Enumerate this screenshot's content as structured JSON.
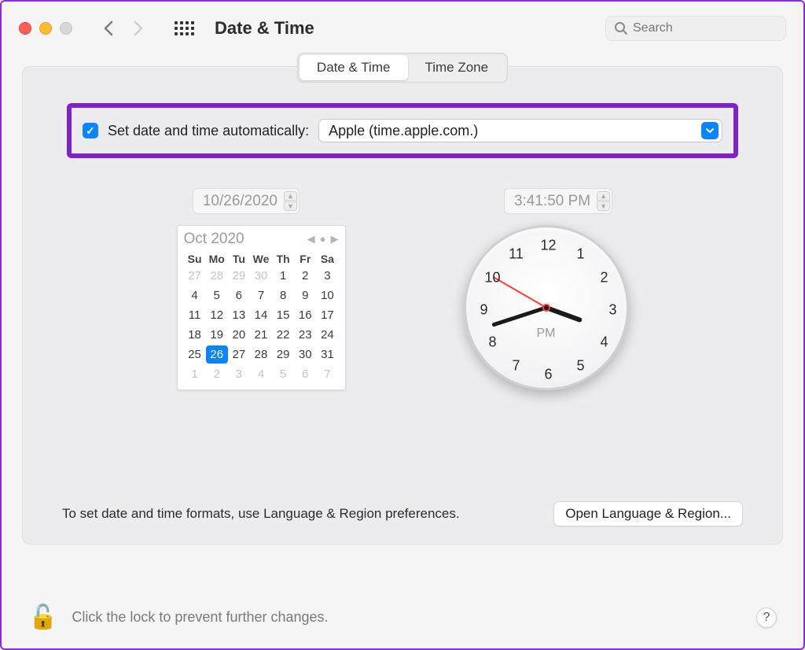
{
  "window": {
    "title": "Date & Time",
    "search_placeholder": "Search"
  },
  "tabs": {
    "date_time": "Date & Time",
    "time_zone": "Time Zone",
    "active": "date_time"
  },
  "auto": {
    "checked": true,
    "label": "Set date and time automatically:",
    "server": "Apple (time.apple.com.)"
  },
  "date_field": "10/26/2020",
  "time_field": "3:41:50 PM",
  "calendar": {
    "month_label": "Oct 2020",
    "dow": [
      "Su",
      "Mo",
      "Tu",
      "We",
      "Th",
      "Fr",
      "Sa"
    ],
    "leading_out": [
      27,
      28,
      29,
      30
    ],
    "days": [
      1,
      2,
      3,
      4,
      5,
      6,
      7,
      8,
      9,
      10,
      11,
      12,
      13,
      14,
      15,
      16,
      17,
      18,
      19,
      20,
      21,
      22,
      23,
      24,
      25,
      26,
      27,
      28,
      29,
      30,
      31
    ],
    "trailing_out": [
      1,
      2,
      3,
      4,
      5,
      6,
      7
    ],
    "selected": 26
  },
  "clock": {
    "numbers": [
      "12",
      "1",
      "2",
      "3",
      "4",
      "5",
      "6",
      "7",
      "8",
      "9",
      "10",
      "11"
    ],
    "ampm": "PM",
    "hour_angle": 110,
    "minute_angle": 252,
    "second_angle": 300
  },
  "footer": {
    "hint": "To set date and time formats, use Language & Region preferences.",
    "button": "Open Language & Region..."
  },
  "lock": {
    "text": "Click the lock to prevent further changes."
  }
}
